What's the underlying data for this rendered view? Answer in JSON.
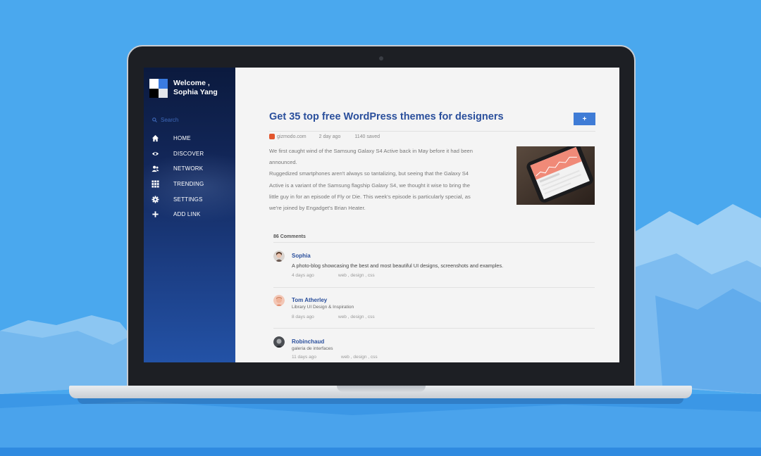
{
  "sidebar": {
    "welcome_line1": "Welcome ,",
    "welcome_line2": "Sophia Yang",
    "search_placeholder": "Search",
    "items": [
      {
        "label": "HOME",
        "icon": "home-icon"
      },
      {
        "label": "DISCOVER",
        "icon": "eye-icon"
      },
      {
        "label": "NETWORK",
        "icon": "network-icon"
      },
      {
        "label": "TRENDING",
        "icon": "grid-icon"
      },
      {
        "label": "SETTINGS",
        "icon": "gear-icon"
      },
      {
        "label": "ADD LINK",
        "icon": "plus-icon"
      }
    ]
  },
  "article": {
    "title": "Get 35 top free WordPress themes for designers",
    "plus_label": "+",
    "source": "gizmodo.com",
    "time": "2 day ago",
    "saved": "1140 saved",
    "para1_line1": "We first caught wind of the Samsung Galaxy S4 Active back in May before it had been",
    "para1_line2": "announced.",
    "para2_line1": "Ruggedized smartphones aren't always so tantalizing, but seeing that the Galaxy S4",
    "para2_line2": "Active is a variant of the Samsung flagship Galaxy S4, we thought it wise to bring the",
    "para2_line3": "little guy in for an episode of Fly or Die. This week's episode is particularly special, as",
    "para2_line4": "we're joined by Engadget's Brian Heater."
  },
  "comments": {
    "count_label": "86 Comments",
    "items": [
      {
        "name": "Sophia",
        "text": "A photo-blog showcasing the best and most beautiful UI designs, screenshots and examples.",
        "time": "4 days ago",
        "tags": "web , design , css"
      },
      {
        "name": "Tom Atherley",
        "text": "Library UI Design & Inspiration",
        "time": "8 days ago",
        "tags": "web , design , css"
      },
      {
        "name": "Robinchaud",
        "text": "galeria de interfaces",
        "time": "11 days ago",
        "tags": "web , design , css"
      }
    ]
  },
  "colors": {
    "background": "#4aa8ee",
    "accent": "#3f7cd6",
    "title": "#2a4f9c"
  }
}
